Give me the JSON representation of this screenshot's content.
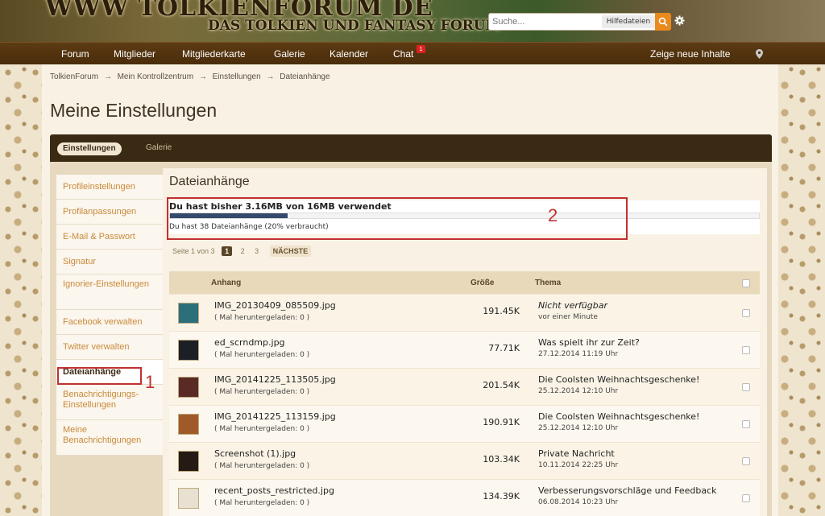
{
  "header": {
    "logo_main": "WWW TOLKIENFORUM DE",
    "logo_sub": "DAS TOLKIEN UND FANTASY FORUM",
    "search_placeholder": "Suche...",
    "search_help": "Hilfedateien"
  },
  "nav": {
    "items": [
      "Forum",
      "Mitglieder",
      "Mitgliederkarte",
      "Galerie",
      "Kalender",
      "Chat"
    ],
    "chat_badge": "1",
    "right_link": "Zeige neue Inhalte"
  },
  "breadcrumb": [
    "TolkienForum",
    "→",
    "Mein Kontrollzentrum",
    "→",
    "Einstellungen",
    "→",
    "Dateianhänge"
  ],
  "page_title": "Meine Einstellungen",
  "tabs": {
    "active": "Einstellungen",
    "other": "Galerie"
  },
  "sidebar": {
    "items": [
      "Profileinstellungen",
      "Profilanpassungen",
      "E-Mail & Passwort",
      "Signatur",
      "Ignorier-Einstellungen",
      "Facebook verwalten",
      "Twitter verwalten",
      "Dateianhänge",
      "Benachrichtigungs-Einstellungen",
      "Meine Benachrichtigungen"
    ],
    "active_index": 7
  },
  "annotations": {
    "one": "1",
    "two": "2"
  },
  "content": {
    "title": "Dateianhänge",
    "usage_title": "Du hast bisher 3.16MB von 16MB verwendet",
    "usage_percent": 20,
    "usage_text": "Du hast 38 Dateianhänge (20% verbraucht)"
  },
  "pager": {
    "label": "Seite 1 von 3",
    "current": "1",
    "pages": [
      "2",
      "3"
    ],
    "next": "NÄCHSTE"
  },
  "table": {
    "headers": {
      "attachment": "Anhang",
      "size": "Größe",
      "topic": "Thema"
    },
    "rows": [
      {
        "name": "IMG_20130409_085509.jpg",
        "downloads": "( Mal heruntergeladen: 0 )",
        "size": "191.45K",
        "topic": "Nicht verfügbar",
        "date": "vor einer Minute",
        "italic": true,
        "thumb_color": "#2b6f7a"
      },
      {
        "name": "ed_scrndmp.jpg",
        "downloads": "( Mal heruntergeladen: 0 )",
        "size": "77.71K",
        "topic": "Was spielt ihr zur Zeit?",
        "date": "27.12.2014 11:19 Uhr",
        "italic": false,
        "thumb_color": "#1c2026"
      },
      {
        "name": "IMG_20141225_113505.jpg",
        "downloads": "( Mal heruntergeladen: 0 )",
        "size": "201.54K",
        "topic": "Die Coolsten Weihnachtsgeschenke!",
        "date": "25.12.2014 12:10 Uhr",
        "italic": false,
        "thumb_color": "#5a2a24"
      },
      {
        "name": "IMG_20141225_113159.jpg",
        "downloads": "( Mal heruntergeladen: 0 )",
        "size": "190.91K",
        "topic": "Die Coolsten Weihnachtsgeschenke!",
        "date": "25.12.2014 12:10 Uhr",
        "italic": false,
        "thumb_color": "#a05a2a"
      },
      {
        "name": "Screenshot (1).jpg",
        "downloads": "( Mal heruntergeladen: 0 )",
        "size": "103.34K",
        "topic": "Private Nachricht",
        "date": "10.11.2014 22:25 Uhr",
        "italic": false,
        "thumb_color": "#241c14"
      },
      {
        "name": "recent_posts_restricted.jpg",
        "downloads": "( Mal heruntergeladen: 0 )",
        "size": "134.39K",
        "topic": "Verbesserungsvorschläge und Feedback",
        "date": "06.08.2014 10:23 Uhr",
        "italic": false,
        "thumb_color": "#e8e0d0"
      }
    ]
  }
}
